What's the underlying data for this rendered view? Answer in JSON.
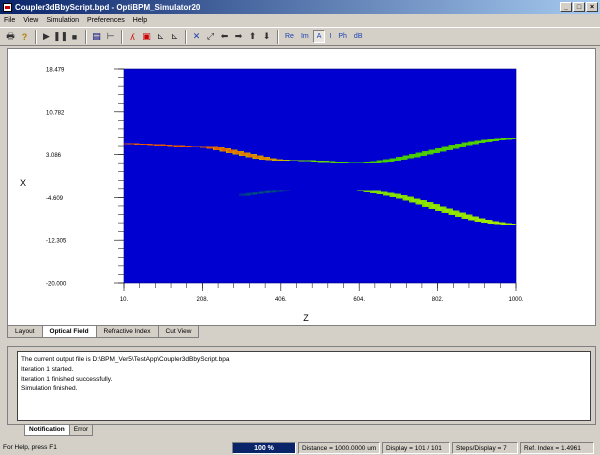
{
  "window": {
    "title": "Coupler3dBbyScript.bpd - OptiBPM_Simulator20",
    "controls": [
      "_",
      "□",
      "×"
    ]
  },
  "menu": [
    "File",
    "View",
    "Simulation",
    "Preferences",
    "Help"
  ],
  "toolbar": {
    "field_buttons": [
      "Re",
      "Im",
      "A",
      "I",
      "Ph",
      "dB"
    ],
    "selected_field": "A",
    "icons": [
      "print-icon",
      "help-icon",
      "run-icon",
      "pause-icon",
      "stop-icon",
      "layout-icon",
      "cut-icon",
      "profile-icon",
      "fit-icon",
      "zoom-x-icon",
      "zoom-y-icon",
      "center-icon",
      "expand-icon",
      "arrow-left-icon",
      "arrow-right-icon",
      "arrow-up-icon",
      "arrow-down-icon"
    ]
  },
  "chart_data": {
    "type": "heatmap",
    "title": "",
    "xlabel": "Z",
    "ylabel": "X",
    "x_ticks": [
      "10.",
      "208.",
      "406.",
      "604.",
      "802.",
      "1000."
    ],
    "y_ticks": [
      "18.479",
      "10.782",
      "3.086",
      "-4.609",
      "-12.305",
      "-20.000"
    ],
    "xlim": [
      10,
      1000
    ],
    "ylim": [
      -20,
      18.479
    ],
    "colormap": [
      "#0000d0",
      "#00c000",
      "#ffff00",
      "#ff0000"
    ],
    "waveguides": [
      {
        "name": "upper",
        "z": [
          10,
          200,
          420,
          604,
          1000
        ],
        "x": [
          5.0,
          4.5,
          2.0,
          1.6,
          6.0
        ]
      },
      {
        "name": "lower",
        "z": [
          10,
          200,
          420,
          604,
          1000
        ],
        "x": [
          -5.0,
          -5.0,
          -3.4,
          -3.4,
          -9.5
        ]
      }
    ],
    "power_upper": {
      "z": [
        10,
        200,
        350,
        500,
        604,
        800,
        1000
      ],
      "p": [
        1.0,
        1.0,
        0.9,
        0.55,
        0.45,
        0.48,
        0.5
      ]
    },
    "power_lower": {
      "z": [
        10,
        200,
        350,
        500,
        604,
        800,
        1000
      ],
      "p": [
        0.0,
        0.0,
        0.1,
        0.45,
        0.6,
        0.65,
        0.7
      ]
    }
  },
  "view_tabs": [
    {
      "label": "Layout",
      "active": false
    },
    {
      "label": "Optical Field",
      "active": true
    },
    {
      "label": "Refractive Index",
      "active": false
    },
    {
      "label": "Cut View",
      "active": false
    }
  ],
  "log_lines": [
    "The current output file is D:\\BPM_Ver5\\TestApp\\Coupler3dBbyScript.bpa",
    "Iteration 1 started.",
    "Iteration 1 finished successfully.",
    "Simulation finished."
  ],
  "notification_tabs": [
    {
      "label": "Notification",
      "active": true
    },
    {
      "label": "Error",
      "active": false
    }
  ],
  "status": {
    "help": "For Help, press F1",
    "zoom": "100 %",
    "distance": "Distance = 1000.0000 um",
    "display": "Display = 101 / 101",
    "steps": "Steps/Display = 7",
    "ref_index": "Ref. Index = 1.4961"
  }
}
